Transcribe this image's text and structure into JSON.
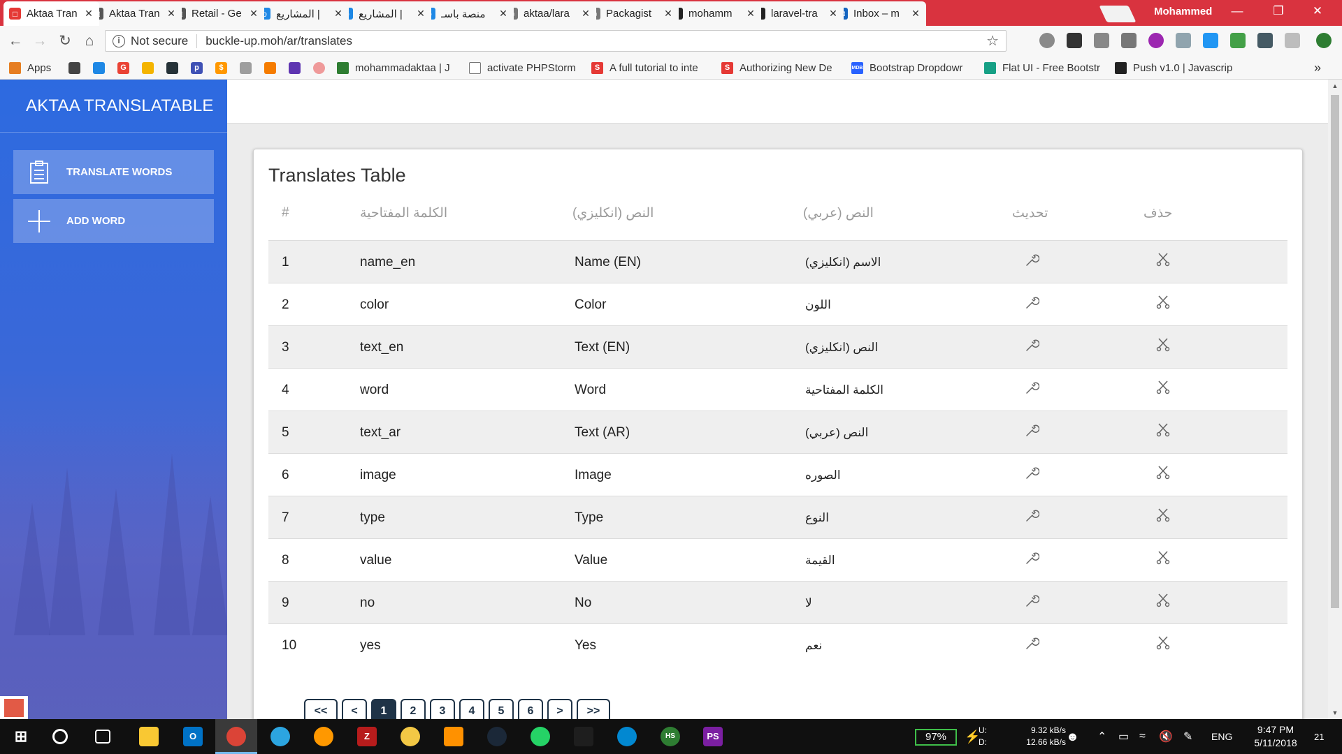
{
  "browser": {
    "tabs": [
      {
        "title": "Aktaa Tran",
        "color": "#e53935",
        "glyph": "□",
        "active": true
      },
      {
        "title": "Aktaa Tran",
        "color": "#555555",
        "glyph": "□",
        "active": false
      },
      {
        "title": "Retail - Ge",
        "color": "#555555",
        "glyph": "□",
        "active": false
      },
      {
        "title": "المشاريع | ",
        "color": "#1e88e5",
        "glyph": "o",
        "active": false
      },
      {
        "title": "المشاريع | ",
        "color": "#1e88e5",
        "glyph": "o",
        "active": false
      },
      {
        "title": "منصة باسـ",
        "color": "#1e88e5",
        "glyph": "o",
        "active": false
      },
      {
        "title": "aktaa/lara",
        "color": "#777777",
        "glyph": "☺",
        "active": false
      },
      {
        "title": "Packagist",
        "color": "#777777",
        "glyph": "☺",
        "active": false
      },
      {
        "title": "mohamm",
        "color": "#222222",
        "glyph": "●",
        "active": false
      },
      {
        "title": "laravel-tra",
        "color": "#222222",
        "glyph": "●",
        "active": false
      },
      {
        "title": "Inbox – m",
        "color": "#1565c0",
        "glyph": "✉",
        "active": false
      }
    ],
    "profile_name": "Mohammed",
    "window_controls": {
      "minimize": "—",
      "restore": "❐",
      "close": "✕"
    },
    "security_label": "Not secure",
    "url": "buckle-up.moh/ar/translates",
    "bookmarks": [
      {
        "label": "Apps",
        "color": "#e67e22"
      },
      {
        "label": "mohammadaktaa | J",
        "color": "#2e7d32"
      },
      {
        "label": "activate PHPStorm",
        "color": "#777777"
      },
      {
        "label": "A full tutorial to inte",
        "color": "#e53935"
      },
      {
        "label": "Authorizing New De",
        "color": "#e53935"
      },
      {
        "label": "Bootstrap Dropdowr",
        "color": "#2962ff"
      },
      {
        "label": "Flat UI - Free Bootstr",
        "color": "#16a085"
      },
      {
        "label": "Push v1.0 | Javascrip",
        "color": "#222222"
      }
    ],
    "bookmark_overflow": "»"
  },
  "sidebar": {
    "brand": "AKTAA TRANSLATABLE",
    "items": [
      {
        "label": "TRANSLATE WORDS",
        "icon": "clipboard-icon"
      },
      {
        "label": "ADD WORD",
        "icon": "plus-icon"
      }
    ]
  },
  "table": {
    "title": "Translates Table",
    "headers": {
      "num": "#",
      "key": "الكلمة المفتاحية",
      "en": "النص (انكليزي)",
      "ar": "النص (عربي)",
      "update": "تحديث",
      "delete": "حذف"
    },
    "rows": [
      {
        "num": "1",
        "key": "name_en",
        "en": "Name (EN)",
        "ar": "الاسم (انكليزي)"
      },
      {
        "num": "2",
        "key": "color",
        "en": "Color",
        "ar": "اللون"
      },
      {
        "num": "3",
        "key": "text_en",
        "en": "Text (EN)",
        "ar": "النص (انكليزي)"
      },
      {
        "num": "4",
        "key": "word",
        "en": "Word",
        "ar": "الكلمة المفتاحية"
      },
      {
        "num": "5",
        "key": "text_ar",
        "en": "Text (AR)",
        "ar": "النص (عربي)"
      },
      {
        "num": "6",
        "key": "image",
        "en": "Image",
        "ar": "الصوره"
      },
      {
        "num": "7",
        "key": "type",
        "en": "Type",
        "ar": "النوع"
      },
      {
        "num": "8",
        "key": "value",
        "en": "Value",
        "ar": "القيمة"
      },
      {
        "num": "9",
        "key": "no",
        "en": "No",
        "ar": "لا"
      },
      {
        "num": "10",
        "key": "yes",
        "en": "Yes",
        "ar": "نعم"
      }
    ],
    "pagination": [
      "<<",
      "<",
      "1",
      "2",
      "3",
      "4",
      "5",
      "6",
      ">",
      ">>"
    ],
    "current_page": "1"
  },
  "taskbar": {
    "battery": "97%",
    "network_upload_label": "U:",
    "network_download_label": "D:",
    "upload_speed": "9.32 kB/s",
    "download_speed": "12.66 kB/s",
    "language": "ENG",
    "time": "9:47 PM",
    "date": "5/11/2018",
    "notification_count": "21"
  },
  "colors": {
    "chrome_red": "#d9333f",
    "sidebar_blue": "#2d6ae0",
    "pager_navy": "#1f3347"
  }
}
